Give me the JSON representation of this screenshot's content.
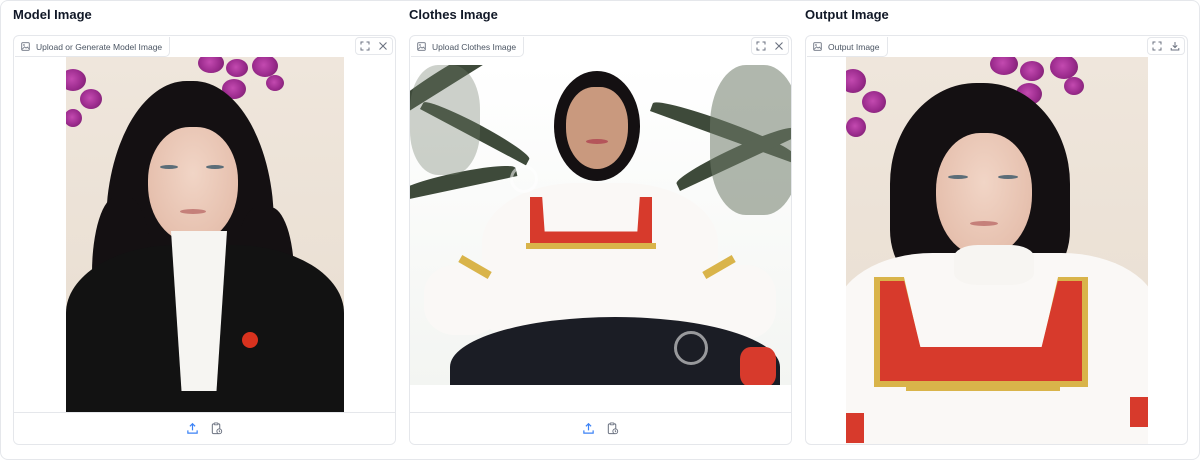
{
  "panels": {
    "model": {
      "title": "Model Image",
      "label": "Upload or Generate Model Image",
      "tools": [
        "fullscreen-icon",
        "close-icon"
      ]
    },
    "clothes": {
      "title": "Clothes Image",
      "label": "Upload Clothes Image",
      "tools": [
        "fullscreen-icon",
        "close-icon"
      ]
    },
    "output": {
      "title": "Output Image",
      "label": "Output Image",
      "tools": [
        "fullscreen-icon",
        "download-icon"
      ]
    }
  },
  "bottom_actions": [
    "upload-icon",
    "paste-clipboard-icon"
  ],
  "colors": {
    "border": "#e5e7eb",
    "icon": "#6b7280",
    "accent_icon": "#3b82f6"
  }
}
